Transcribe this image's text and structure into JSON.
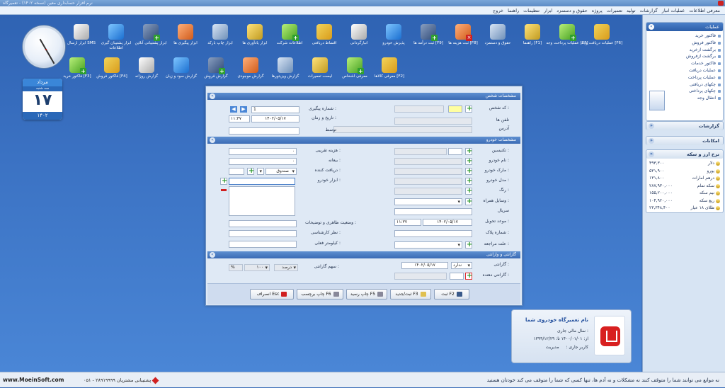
{
  "titlebar": {
    "title": "نرم افزار حسابداری معین (نسخه ۱۴۰۲) - تعمیرگاه"
  },
  "menu": [
    "معرفی اطلاعات",
    "عملیات انبار",
    "گزارشات",
    "تولید",
    "تعمیرات",
    "پروژه",
    "حقوق و دستمزد",
    "ابزار",
    "تنظیمات",
    "راهنما",
    "خروج"
  ],
  "calendar": {
    "month": "مرداد",
    "weekday": "سه شنبه",
    "day": "۱۷",
    "year": "۱۴۰۲"
  },
  "toolbar_row1": [
    {
      "label": "عملیات دریافت وجه [F6]",
      "icon": "coins-in-icon"
    },
    {
      "label": "عملیات پرداخت وجه [F7]",
      "icon": "coins-out-icon"
    },
    {
      "label": "راهنما [F1]",
      "icon": "help-icon"
    },
    {
      "label": "حقوق و دستمزد",
      "icon": "payroll-icon"
    },
    {
      "label": "ثبت هزینه ها [F8]",
      "icon": "expense-icon"
    },
    {
      "label": "ثبت درآمد ها [F9]",
      "icon": "income-icon"
    },
    {
      "label": "پذیرش خودرو",
      "icon": "car-admission-icon"
    },
    {
      "label": "انبارگردانی",
      "icon": "inventory-icon"
    },
    {
      "label": "اقساط دریافتی",
      "icon": "installments-icon"
    },
    {
      "label": "اطلاعات شرکت",
      "icon": "company-icon"
    },
    {
      "label": "ابزار یادآوری ها",
      "icon": "reminder-icon"
    },
    {
      "label": "ابزار چاپ بارکد",
      "icon": "barcode-icon"
    },
    {
      "label": "ابزار پیگیری ها",
      "icon": "followup-icon"
    },
    {
      "label": "ابزار پشتیبانی آنلاین",
      "icon": "teamviewer-icon"
    },
    {
      "label": "ابزار پشتیبان گیری اطلاعات",
      "icon": "backup-icon"
    },
    {
      "label": "ابزار ارسال SMS",
      "icon": "sms-icon"
    }
  ],
  "toolbar_row2": [
    {
      "label": "معرفی کالاها [F2]",
      "icon": "products-icon"
    },
    {
      "label": "معرفی اشخاص",
      "icon": "persons-icon"
    },
    {
      "label": "لیست تعمیرات",
      "icon": "repairs-list-icon"
    },
    {
      "label": "گزارش ویزیتورها",
      "icon": "visitors-report-icon"
    },
    {
      "label": "گزارش موجودی",
      "icon": "stock-report-icon"
    },
    {
      "label": "گزارش فروش",
      "icon": "sales-report-icon"
    },
    {
      "label": "گزارش سود و زیان",
      "icon": "profit-loss-icon"
    },
    {
      "label": "گزارش روزانه",
      "icon": "daily-report-icon"
    },
    {
      "label": "فاکتور فروش [F4]",
      "icon": "sale-invoice-icon"
    },
    {
      "label": "فاکتور خرید [F3]",
      "icon": "purchase-invoice-icon"
    }
  ],
  "right_panel": {
    "ops_title": "عملیات",
    "ops_items": [
      "فاکتور خرید",
      "فاکتور فروش",
      "برگشت ازخرید",
      "برگشت ازفروش",
      "فاکتور خدمات",
      "عملیات دریافت",
      "عملیات پرداخت",
      "چکهای دریافتی",
      "چکهای پرداختی",
      "انتقال وجه"
    ],
    "reports_title": "گزارشات",
    "features_title": "امکانات",
    "rates_title": "نرخ ارز و سکه",
    "rates": [
      {
        "name": "دلار",
        "value": "۴۹۳,۳۰۰"
      },
      {
        "name": "یورو",
        "value": "۵۳۱,۹۰۰"
      },
      {
        "name": "درهم امارات",
        "value": "۱۳۱,۸۰۰"
      },
      {
        "name": "سکه تمام",
        "value": "۲۸۷,۹۳۰,۰۰۰"
      },
      {
        "name": "نیم سکه",
        "value": "۱۵۵,۲۰۰,۰۰۰"
      },
      {
        "name": "ربع سکه",
        "value": "۱۰۴,۹۲۰,۰۰۰"
      },
      {
        "name": "طلای ۱۸ عیار",
        "value": "۲۳,۳۴۸,۴۰۰"
      }
    ]
  },
  "dialog": {
    "person_group": "مشخصات شخص",
    "car_group": "مشخصات خودرو",
    "warranty_group": "گارانتی و وارانتی",
    "labels": {
      "person_code": "کد شخص :",
      "phones": "تلفن ها",
      "address": "آدرس",
      "tracking_no": "شماره پیگیری :",
      "datetime": "تاریخ و زمان :",
      "by": "توسط",
      "technician": "تکنیسین :",
      "car_name": "نام خودرو :",
      "car_brand": "مارک خودرو :",
      "car_model": "مدل خودرو :",
      "color": "رنگ :",
      "accessories": "وسایل همراه :",
      "serial": "سریال",
      "delivery": "موعد تحویل :",
      "plate": "شماره پلاک :",
      "reason": "علت مراجعه :",
      "approx_cost": "هزینه تقریبی :",
      "deposit": "بیعانه :",
      "receiver": "دریافت کننده :",
      "car_tools": "ابزار خودرو :",
      "appearance": "وضعیت ظاهری و توضیحات :",
      "expert_opinion": "نظر کارشناسی :",
      "odometer": "کیلومتر فعلی :",
      "warranty": "گارانتی :",
      "warranty_giver": "گارانتی دهنده :",
      "warranty_share": "سهم گارانتی :"
    },
    "values": {
      "tracking_no": "1",
      "date": "۱۴۰۲/۰۵/۱۷",
      "time": "۱۱:۳۷",
      "approx_cost": "۰",
      "deposit": "۰",
      "receiver": "صندوق",
      "delivery_date": "۱۴۰۲/۰۵/۱۷",
      "delivery_time": "۱۱:۳۷",
      "warranty": "ندارد",
      "warranty_date": "۱۴۰۲/۰۵/۱۷",
      "share_type": "درصد",
      "share_value": "۱۰۰",
      "share_unit": "%"
    },
    "buttons": {
      "save": "ثبت F2",
      "save_new": "ثبت/جدید F3",
      "print_receipt": "چاپ رسید F5",
      "print_label": "چاپ برچسب F6",
      "cancel": "انصراف Esc"
    }
  },
  "brand": {
    "name": "نام تعمیرگاه خودروی شما",
    "fiscal_year_label": "سال مالی جاری :",
    "from_label": "از:",
    "from_date": "۱۴۰۰/۰۱/۰۱",
    "to_label": "تا:",
    "to_date": "۱۳۹۹/۱۲/۲۹",
    "user_label": "کاربر جاری :",
    "user": "مدیریت"
  },
  "statusbar": {
    "news": "نه موانع می توانند شما را متوقف کنند نه مشکلات و نه آدم ها، تنها کسی که شما را متوقف می کند خودتان هستید",
    "support": "پشتیبانی مشتریان ۲۸۹۱۹۹۹۹ - ۰۵۱",
    "website": "www.MoeinSoft.com"
  },
  "colors": {
    "accent": "#3a6bb5",
    "desktop": "#3d6fb8",
    "panel": "#d7e4f3",
    "plus": "#2fa02f",
    "danger": "#d02020"
  }
}
